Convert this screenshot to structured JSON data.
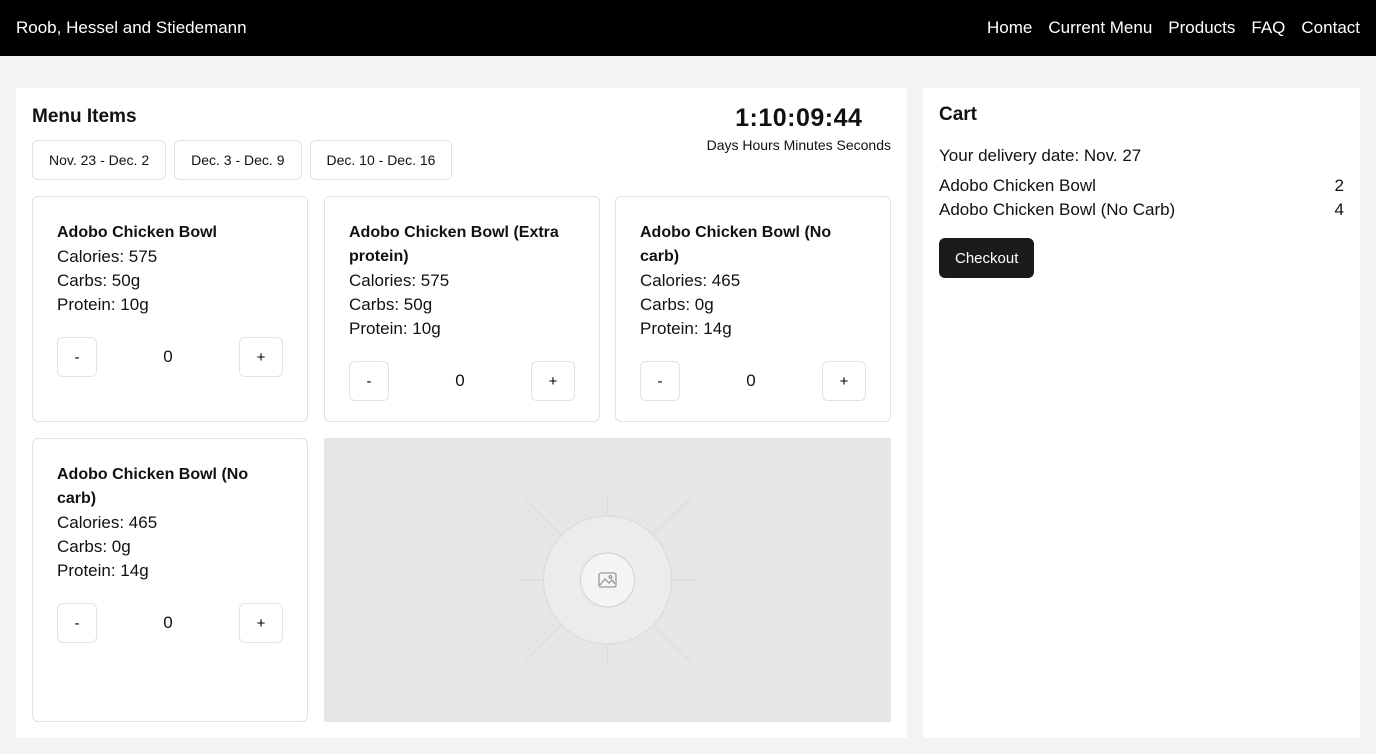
{
  "header": {
    "brand": "Roob, Hessel and Stiedemann",
    "nav": [
      "Home",
      "Current Menu",
      "Products",
      "FAQ",
      "Contact"
    ]
  },
  "menu": {
    "title": "Menu Items",
    "weeks": [
      "Nov. 23 - Dec. 2",
      "Dec. 3 - Dec. 9",
      "Dec. 10 - Dec. 16"
    ],
    "countdown": {
      "time": "1:10:09:44",
      "units": "Days Hours Minutes Seconds"
    },
    "items": [
      {
        "name": "Adobo Chicken Bowl",
        "calories": "Calories: 575",
        "carbs": "Carbs: 50g",
        "protein": "Protein: 10g",
        "qty": "0"
      },
      {
        "name": "Adobo Chicken Bowl (Extra protein)",
        "calories": "Calories: 575",
        "carbs": "Carbs: 50g",
        "protein": "Protein: 10g",
        "qty": "0"
      },
      {
        "name": "Adobo Chicken Bowl (No carb)",
        "calories": "Calories: 465",
        "carbs": "Carbs: 0g",
        "protein": "Protein: 14g",
        "qty": "0"
      },
      {
        "name": "Adobo Chicken Bowl (No carb)",
        "calories": "Calories: 465",
        "carbs": "Carbs: 0g",
        "protein": "Protein: 14g",
        "qty": "0"
      }
    ],
    "minus_label": "-",
    "plus_label": "+"
  },
  "cart": {
    "title": "Cart",
    "delivery": "Your delivery date: Nov. 27",
    "items": [
      {
        "name": "Adobo Chicken Bowl",
        "qty": "2"
      },
      {
        "name": "Adobo Chicken Bowl (No Carb)",
        "qty": "4"
      }
    ],
    "checkout_label": "Checkout"
  }
}
